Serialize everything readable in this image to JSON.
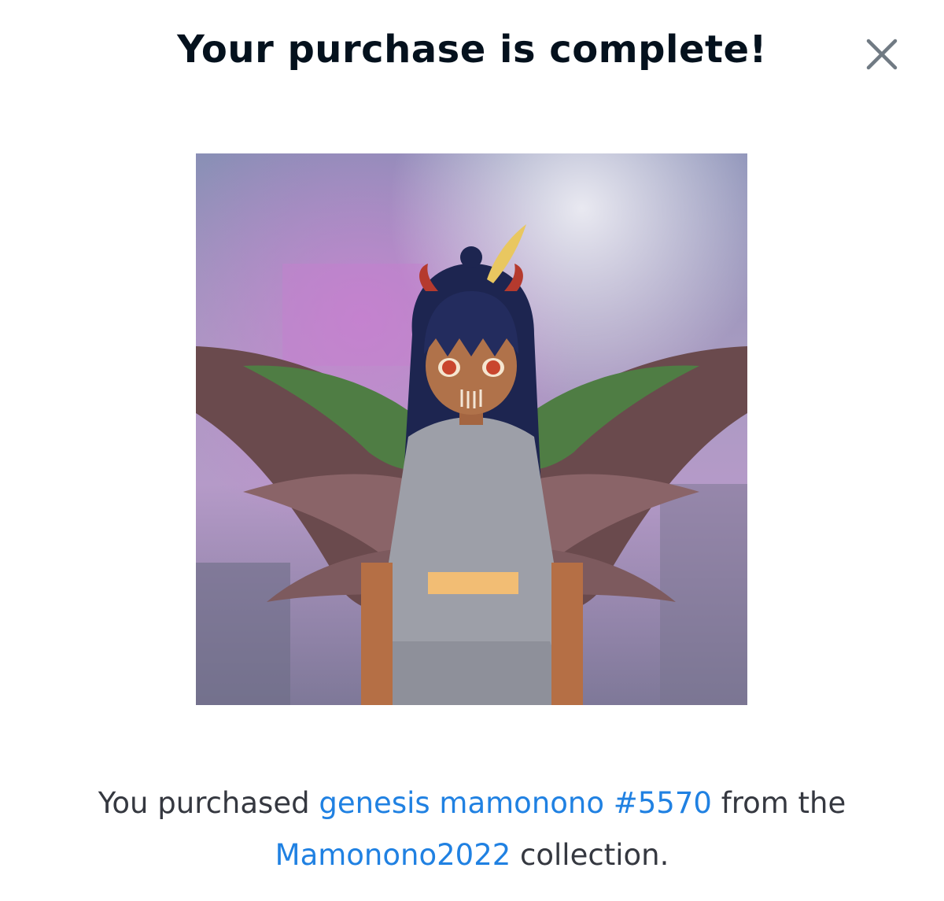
{
  "modal": {
    "title": "Your purchase is complete!",
    "close_icon": "close-icon"
  },
  "artwork": {
    "icon": "nft-artwork-image"
  },
  "message": {
    "prefix": "You purchased",
    "item_name": "genesis mamonono #5570",
    "middle": "from the",
    "collection_name": "Mamonono2022",
    "suffix": "collection."
  },
  "colors": {
    "title": "#04111d",
    "text": "#353840",
    "link": "#2081e2",
    "close": "#707a83"
  }
}
